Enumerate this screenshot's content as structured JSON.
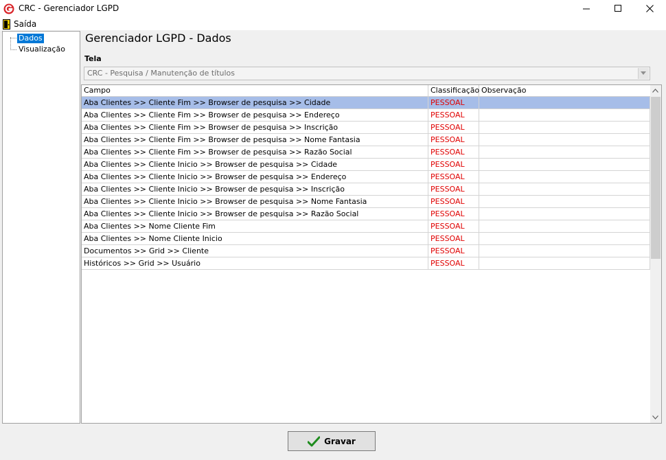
{
  "window": {
    "title": "CRC - Gerenciador LGPD"
  },
  "menu": {
    "saida": "Saída"
  },
  "tree": {
    "items": [
      "Dados",
      "Visualização"
    ],
    "selected": 0
  },
  "main": {
    "heading": "Gerenciador LGPD - Dados",
    "tela_label": "Tela",
    "tela_value": "CRC - Pesquisa / Manutenção de títulos"
  },
  "grid": {
    "columns": [
      "Campo",
      "Classificação",
      "Observação"
    ],
    "rows": [
      [
        "Aba Clientes >> Cliente Fim >> Browser de pesquisa >> Cidade",
        "PESSOAL",
        ""
      ],
      [
        "Aba Clientes >> Cliente Fim >> Browser de pesquisa >> Endereço",
        "PESSOAL",
        ""
      ],
      [
        "Aba Clientes >> Cliente Fim >> Browser de pesquisa >> Inscrição",
        "PESSOAL",
        ""
      ],
      [
        "Aba Clientes >> Cliente Fim >> Browser de pesquisa >> Nome Fantasia",
        "PESSOAL",
        ""
      ],
      [
        "Aba Clientes >> Cliente Fim >> Browser de pesquisa >> Razão Social",
        "PESSOAL",
        ""
      ],
      [
        "Aba Clientes >> Cliente Inicio >> Browser de pesquisa >> Cidade",
        "PESSOAL",
        ""
      ],
      [
        "Aba Clientes >> Cliente Inicio >> Browser de pesquisa >> Endereço",
        "PESSOAL",
        ""
      ],
      [
        "Aba Clientes >> Cliente Inicio >> Browser de pesquisa >> Inscrição",
        "PESSOAL",
        ""
      ],
      [
        "Aba Clientes >> Cliente Inicio >> Browser de pesquisa >> Nome Fantasia",
        "PESSOAL",
        ""
      ],
      [
        "Aba Clientes >> Cliente Inicio >> Browser de pesquisa >> Razão Social",
        "PESSOAL",
        ""
      ],
      [
        "Aba Clientes >> Nome Cliente Fim",
        "PESSOAL",
        ""
      ],
      [
        "Aba Clientes >> Nome Cliente Inicio",
        "PESSOAL",
        ""
      ],
      [
        "Documentos >> Grid >> Cliente",
        "PESSOAL",
        ""
      ],
      [
        "Históricos >> Grid >> Usuário",
        "PESSOAL",
        ""
      ]
    ],
    "selected_row": 0
  },
  "footer": {
    "gravar": "Gravar"
  },
  "colors": {
    "selection": "#a6bde8",
    "classification_text": "#e00000",
    "tree_selection": "#0078d7"
  }
}
